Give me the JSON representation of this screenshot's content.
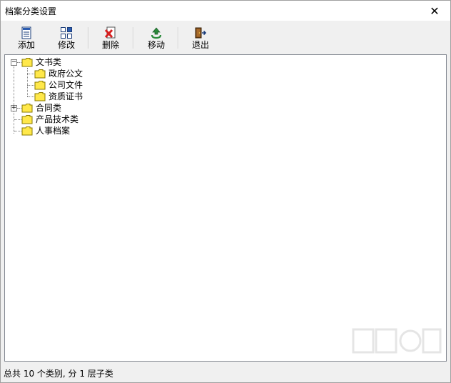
{
  "window": {
    "title": "档案分类设置",
    "close_glyph": "✕"
  },
  "toolbar": {
    "buttons": [
      {
        "label": "添加",
        "icon": "document-icon"
      },
      {
        "label": "修改",
        "icon": "grid-icon"
      },
      {
        "label": "删除",
        "icon": "delete-icon"
      },
      {
        "label": "移动",
        "icon": "recycle-icon"
      },
      {
        "label": "退出",
        "icon": "exit-door-icon"
      }
    ]
  },
  "tree": {
    "nodes": [
      {
        "label": "文书类",
        "expanded": true,
        "children": [
          "政府公文",
          "公司文件",
          "资质证书"
        ]
      },
      {
        "label": "合同类",
        "expanded": false,
        "children": []
      },
      {
        "label": "产品技术类",
        "expanded": false,
        "children": []
      },
      {
        "label": "人事档案",
        "expanded": false,
        "children": []
      }
    ],
    "expand_glyph_collapsed": "+",
    "expand_glyph_expanded": "−"
  },
  "status": {
    "text": "总共 10 个类别, 分 1 层子类"
  },
  "colors": {
    "folder_fill": "#ffe84a",
    "folder_stroke": "#8a7a00",
    "delete_red": "#d62020",
    "recycle_green": "#2a8a3a"
  }
}
